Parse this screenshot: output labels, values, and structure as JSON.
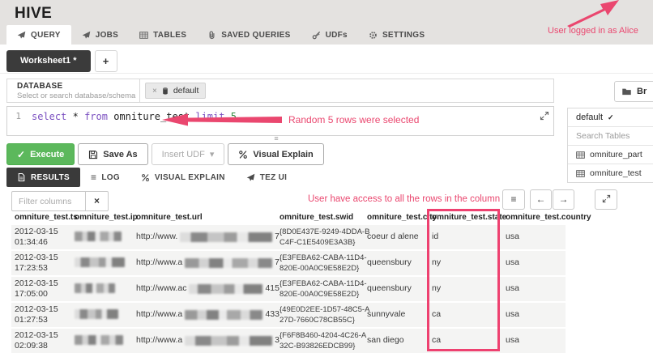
{
  "header": {
    "title": "HIVE",
    "tabs": [
      {
        "label": "QUERY",
        "active": true
      },
      {
        "label": "JOBS"
      },
      {
        "label": "TABLES"
      },
      {
        "label": "SAVED QUERIES"
      },
      {
        "label": "UDFs"
      },
      {
        "label": "SETTINGS"
      }
    ]
  },
  "annotations": {
    "logged_in": "User logged in as Alice",
    "random_rows": "Random 5 rows were selected",
    "column_access": "User have access to all the rows in the column"
  },
  "worksheets": {
    "active_tab": "Worksheet1 *"
  },
  "database_panel": {
    "label": "DATABASE",
    "hint": "Select or search database/schema",
    "selected_tag": "default"
  },
  "browse_button": {
    "label": "Br"
  },
  "editor": {
    "line_number": "1",
    "query": {
      "kw_select": "select",
      "star": "*",
      "kw_from": "from",
      "table": "omniture_test",
      "kw_limit": "limit",
      "num": "5"
    }
  },
  "actions": {
    "execute": "Execute",
    "save_as": "Save As",
    "insert_udf": "Insert UDF",
    "visual_explain": "Visual Explain"
  },
  "result_tabs": [
    {
      "label": "RESULTS",
      "active": true
    },
    {
      "label": "LOG"
    },
    {
      "label": "VISUAL EXPLAIN"
    },
    {
      "label": "TEZ UI"
    }
  ],
  "results_toolbar": {
    "filter_placeholder": "Filter columns"
  },
  "table": {
    "columns": [
      "omniture_test.ts",
      "omniture_test.ip",
      "omniture_test.url",
      "omniture_test.swid",
      "omniture_test.city",
      "omniture_test.state",
      "omniture_test.country"
    ],
    "rows": [
      {
        "ts": "2012-03-15 01:34:46",
        "url_prefix": "http://www.",
        "url_suffix": "7",
        "swid": "{8D0E437E-9249-4DDA-BC4F-C1E5409E3A3B}",
        "city": "coeur d alene",
        "state": "id",
        "country": "usa"
      },
      {
        "ts": "2012-03-15 17:23:53",
        "url_prefix": "http://www.a",
        "url_suffix": "7",
        "swid": "{E3FEBA62-CABA-11D4-820E-00A0C9E58E2D}",
        "city": "queensbury",
        "state": "ny",
        "country": "usa"
      },
      {
        "ts": "2012-03-15 17:05:00",
        "url_prefix": "http://www.ac",
        "url_suffix": "415",
        "swid": "{E3FEBA62-CABA-11D4-820E-00A0C9E58E2D}",
        "city": "queensbury",
        "state": "ny",
        "country": "usa"
      },
      {
        "ts": "2012-03-15 01:27:53",
        "url_prefix": "http://www.a",
        "url_suffix": "433",
        "swid": "{49E0D2EE-1D57-48C5-A27D-7660C78CB55C}",
        "city": "sunnyvale",
        "state": "ca",
        "country": "usa"
      },
      {
        "ts": "2012-03-15 02:09:38",
        "url_prefix": "http://www.a",
        "url_suffix": "3",
        "swid": "{F6F8B460-4204-4C26-A32C-B93826EDCB99}",
        "city": "san diego",
        "state": "ca",
        "country": "usa"
      }
    ]
  },
  "sidebar": {
    "database_header": "default",
    "search_placeholder": "Search Tables",
    "tables": [
      "omniture_part",
      "omniture_test"
    ]
  },
  "icons": {
    "close": "×",
    "check": "✓",
    "menu": "≡",
    "arrow_left": "←",
    "arrow_right": "→",
    "caret_down": "▾",
    "add": "+"
  },
  "colors": {
    "accent_pink": "#ea476f",
    "execute_green": "#5cb85c",
    "highlight_border": "#ee4170",
    "active_tab_dark": "#3a3a3a",
    "header_gray": "#e4e2e0"
  }
}
